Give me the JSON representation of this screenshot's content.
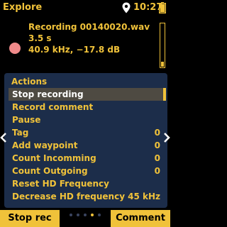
{
  "status_bar": {
    "title": "Explore",
    "time": "10:27",
    "location_icon": "location-pin-icon",
    "battery_icon": "battery-icon"
  },
  "recording": {
    "indicator_icon": "recording-dot-icon",
    "filename_line": "Recording 00140020.wav",
    "duration": "3.5 s",
    "details": "40.9 kHz, −17.8 dB",
    "level_fraction": 0.12
  },
  "actions_panel": {
    "title": "Actions",
    "items": [
      {
        "label": "Stop recording",
        "value": ""
      },
      {
        "label": "Record comment",
        "value": ""
      },
      {
        "label": "Pause",
        "value": ""
      },
      {
        "label": "Tag",
        "value": "0"
      },
      {
        "label": "Add waypoint",
        "value": "0"
      },
      {
        "label": "Count Incomming",
        "value": "0"
      },
      {
        "label": "Count Outgoing",
        "value": "0"
      },
      {
        "label": "Reset HD Frequency",
        "value": ""
      },
      {
        "label": "Decrease HD frequency",
        "value": "45 kHz"
      }
    ],
    "selected_index": 0
  },
  "navigation": {
    "left_arrow_icon": "chevron-left-icon",
    "right_arrow_icon": "chevron-right-icon"
  },
  "bottom_bar": {
    "left_softkey": "Stop rec",
    "right_softkey": "Comment",
    "page_count": 5,
    "active_page": 3
  },
  "colors": {
    "background": "#000000",
    "accent": "#f0c23a",
    "panel": "#1c2d4a",
    "selection": "#4e4a42",
    "recording_dot": "#f08a8a",
    "inactive_dot": "#3a4460"
  }
}
